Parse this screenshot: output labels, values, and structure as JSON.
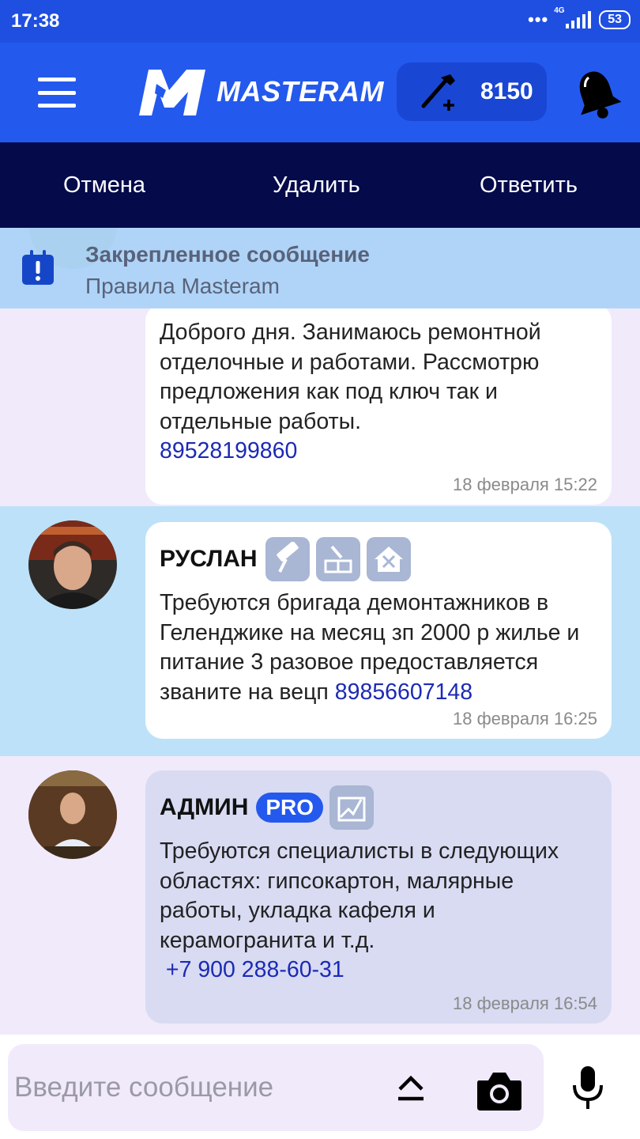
{
  "status_bar": {
    "time": "17:38",
    "network": "4G",
    "battery": "53"
  },
  "header": {
    "logo_text": "MASTERAM",
    "coins": "8150"
  },
  "actions": {
    "cancel": "Отмена",
    "delete": "Удалить",
    "reply": "Ответить"
  },
  "pinned": {
    "title": "Закрепленное сообщение",
    "subtitle": "Правила Masteram"
  },
  "messages": [
    {
      "text": "Доброго дня. Занимаюсь ремонтной отделочные и работами. Рассмотрю предложения как под ключ так и отдельные работы.",
      "phone": "89528199860",
      "time": "18 февраля 15:22"
    },
    {
      "sender": "РУСЛАН",
      "text": "Требуются бригада демонтажников в Геленджике на месяц зп 2000 р жилье и питание 3 разовое  предоставляется званите на вецп",
      "phone": "89856607148",
      "time": "18 февраля 16:25"
    },
    {
      "sender": "АДМИН",
      "badge": "PRO",
      "text": "Требуются специалисты в следующих областях: гипсокартон, малярные работы, укладка кафеля и керамогранита и т.д.",
      "phone": "+7 900 288-60-31",
      "time": "18 февраля 16:54"
    }
  ],
  "input": {
    "placeholder": "Введите сообщение"
  },
  "colors": {
    "header": "#2459ee",
    "action_bar": "#040a4a",
    "pinned": "#add2f8",
    "link": "#1c2ab5"
  }
}
